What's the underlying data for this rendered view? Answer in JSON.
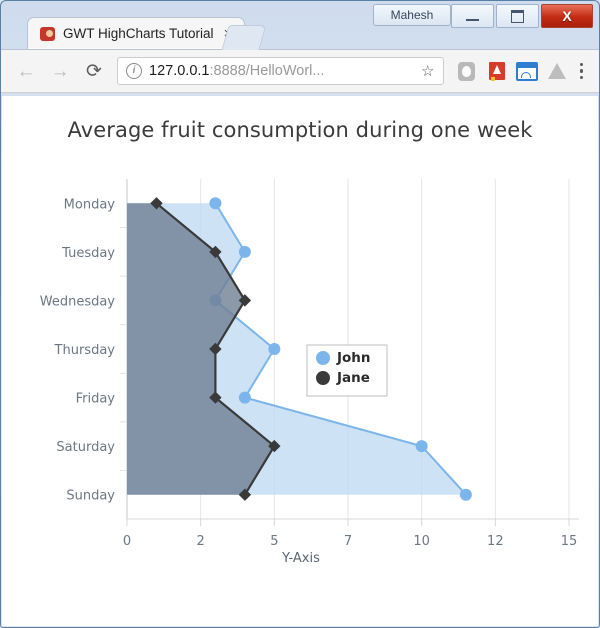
{
  "window": {
    "caption": "Mahesh",
    "minimize_label": "–",
    "maximize_label": "□",
    "close_label": "X"
  },
  "tab": {
    "title": "GWT HighCharts Tutorial",
    "close_label": "×",
    "favicon_name": "gwt-logo-icon"
  },
  "toolbar": {
    "back_label": "←",
    "forward_label": "→",
    "reload_label": "⟳",
    "url_host": "127.0.0.1",
    "url_rest": ":8888/HelloWorl...",
    "bookmark_label": "☆",
    "menu_label": "⋮"
  },
  "chart_data": {
    "type": "area",
    "title": "Average fruit consumption during one week",
    "subtitle": "",
    "orientation": "horizontal",
    "xlabel": "",
    "ylabel": "Y-Axis",
    "categories": [
      "Monday",
      "Tuesday",
      "Wednesday",
      "Thursday",
      "Friday",
      "Saturday",
      "Sunday"
    ],
    "tick_labels": [
      "0",
      "2",
      "5",
      "7",
      "10",
      "12",
      "15"
    ],
    "tick_values": [
      0,
      2.5,
      5,
      7.5,
      10,
      12.5,
      15
    ],
    "ylim": [
      0,
      15
    ],
    "grid": true,
    "legend_position": "center-right",
    "series": [
      {
        "name": "John",
        "color": "#7cb5ec",
        "fill": "#bcd8f2",
        "marker": "circle",
        "values": [
          3,
          4,
          3,
          5,
          4,
          10,
          11.5
        ]
      },
      {
        "name": "Jane",
        "color": "#3a3a3a",
        "fill": "#6f7f93",
        "marker": "diamond",
        "values": [
          1,
          3,
          4,
          3,
          3,
          5,
          4
        ]
      }
    ]
  }
}
